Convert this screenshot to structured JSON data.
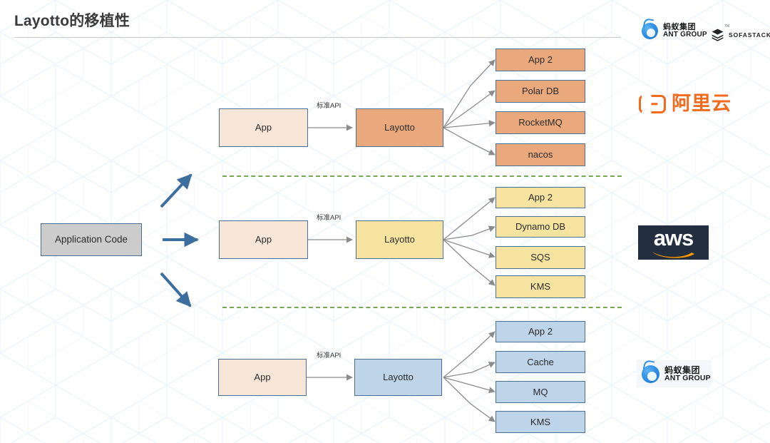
{
  "header": {
    "title": "Layotto的移植性",
    "logos": [
      {
        "name": "ant-group",
        "cn": "蚂蚁集团",
        "en": "ANT GROUP"
      },
      {
        "name": "sofastack",
        "text": "SOFASTACK",
        "tm": "TM"
      }
    ]
  },
  "source": {
    "label": "Application Code"
  },
  "api_label": "标准API",
  "rows": [
    {
      "id": "alicloud",
      "app": "App",
      "middleware": "Layotto",
      "api": "标准API",
      "targets": [
        "App 2",
        "Polar DB",
        "RocketMQ",
        "nacos"
      ],
      "logo": {
        "name": "alibaba-cloud",
        "text": "阿里云"
      },
      "color": "#e9a97c",
      "border": "#4a7098"
    },
    {
      "id": "aws",
      "app": "App",
      "middleware": "Layotto",
      "api": "标准API",
      "targets": [
        "App 2",
        "Dynamo DB",
        "SQS",
        "KMS"
      ],
      "logo": {
        "name": "aws",
        "text": "aws"
      },
      "color": "#f6e3a0",
      "border": "#4a7098"
    },
    {
      "id": "antgroup",
      "app": "App",
      "middleware": "Layotto",
      "api": "标准API",
      "targets": [
        "App 2",
        "Cache",
        "MQ",
        "KMS"
      ],
      "logo": {
        "name": "ant-group",
        "cn": "蚂蚁集团",
        "en": "ANT GROUP"
      },
      "color": "#bed4e9",
      "border": "#4a7098"
    }
  ],
  "colors": {
    "app_box": "#f7e6d7",
    "app_code_box": "#cccccc",
    "box_border": "#4a7098",
    "divider_green": "#7aa851",
    "arrow_blue": "#3d6f9e",
    "arrow_gray": "#8c8c8c",
    "title_text": "#3a3a3a",
    "bg_pattern": "#d9e8f7",
    "aliyun_orange": "#f06b1e",
    "aws_navy": "#232f3e",
    "ant_blue": "#2f8fe3"
  }
}
